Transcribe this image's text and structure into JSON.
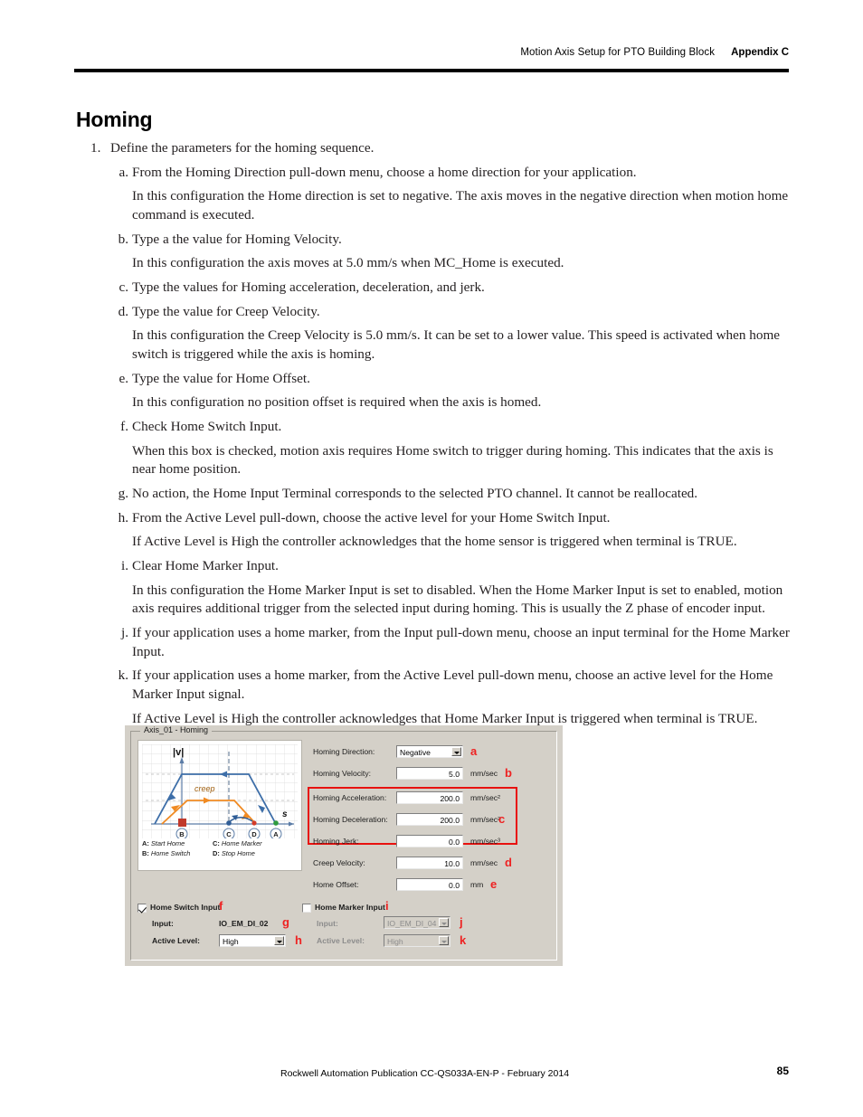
{
  "header": {
    "running_head": "Motion Axis Setup for PTO Building Block",
    "appendix": "Appendix C"
  },
  "page_title": "Homing",
  "steps": {
    "step1_marker": "1.",
    "step1_text": "Define the parameters for the homing sequence.",
    "items": [
      {
        "marker": "a.",
        "text": "From the Homing Direction pull-down menu, choose a home direction for your application."
      },
      {
        "marker": "b.",
        "text": "Type a the value for Homing Velocity."
      },
      {
        "marker": "c.",
        "text": "Type the values for Homing acceleration, deceleration, and jerk."
      },
      {
        "marker": "d.",
        "text": "Type the value for Creep Velocity."
      },
      {
        "marker": "e.",
        "text": "Type the value for Home Offset."
      },
      {
        "marker": "f.",
        "text": "Check Home Switch Input."
      },
      {
        "marker": "g.",
        "text": "No action, the Home Input Terminal corresponds to the selected PTO channel. It cannot be reallocated."
      },
      {
        "marker": "h.",
        "text": "From the Active Level pull-down, choose the active level for your Home Switch Input."
      },
      {
        "marker": "i.",
        "text": "Clear Home Marker Input."
      },
      {
        "marker": "j.",
        "text": "If your application uses a home marker, from the Input pull-down menu, choose an input terminal for the Home Marker Input."
      },
      {
        "marker": "k.",
        "text": "If your application uses a home marker, from the Active Level pull-down menu, choose an active level for the Home Marker Input signal."
      }
    ],
    "notes": {
      "a": "In this configuration the Home direction is set to negative. The axis moves in the negative direction when motion home command is executed.",
      "b": "In this configuration the axis moves at 5.0 mm/s when MC_Home is executed.",
      "d": "In this configuration the Creep Velocity is 5.0 mm/s. It can be set to a lower value. This speed is activated when home switch is triggered while the axis is homing.",
      "e": "In this configuration no position offset is required when the axis is homed.",
      "f": "When this box is checked, motion axis requires Home switch to trigger during homing. This indicates that the axis is near home position.",
      "h": "If Active Level is High the controller acknowledges that the home sensor is triggered when terminal is TRUE.",
      "i": "In this configuration the Home Marker Input is set to disabled. When the Home Marker Input is set to enabled, motion axis requires additional trigger from the selected input during homing. This is usually the Z phase of encoder input.",
      "k": "If Active Level is High the controller acknowledges that Home Marker Input is triggered when terminal is TRUE."
    }
  },
  "dialog": {
    "groupbox_title": "Axis_01 - Homing",
    "chart": {
      "y_axis_label": "|v|",
      "x_axis_label": "s",
      "creep_label": "creep",
      "point_labels": [
        "B",
        "C",
        "D",
        "A"
      ],
      "legend": [
        {
          "key": "A:",
          "value": "Start Home"
        },
        {
          "key": "C:",
          "value": "Home Marker"
        },
        {
          "key": "B:",
          "value": "Home Switch"
        },
        {
          "key": "D:",
          "value": "Stop Home"
        }
      ]
    },
    "fields": [
      {
        "label": "Homing Direction:",
        "value": "Negative",
        "unit": "",
        "type": "select",
        "annotation": "a"
      },
      {
        "label": "Homing Velocity:",
        "value": "5.0",
        "unit": "mm/sec",
        "type": "text",
        "annotation": "b"
      },
      {
        "label": "Homing Acceleration:",
        "value": "200.0",
        "unit": "mm/sec²",
        "type": "text",
        "annotation": ""
      },
      {
        "label": "Homing Deceleration:",
        "value": "200.0",
        "unit": "mm/sec²",
        "type": "text",
        "annotation": "c"
      },
      {
        "label": "Homing Jerk:",
        "value": "0.0",
        "unit": "mm/sec³",
        "type": "text",
        "annotation": ""
      },
      {
        "label": "Creep Velocity:",
        "value": "10.0",
        "unit": "mm/sec",
        "type": "text",
        "annotation": "d"
      },
      {
        "label": "Home Offset:",
        "value": "0.0",
        "unit": "mm",
        "type": "text",
        "annotation": "e"
      }
    ],
    "home_switch": {
      "checkbox_label": "Home Switch Input",
      "checked": true,
      "input_label": "Input:",
      "input_value": "IO_EM_DI_02",
      "active_level_label": "Active Level:",
      "active_level_value": "High",
      "annotation_checkbox": "f",
      "annotation_input": "g",
      "annotation_level": "h"
    },
    "home_marker": {
      "checkbox_label": "Home Marker Input",
      "checked": false,
      "input_label": "Input:",
      "input_value": "IO_EM_DI_04",
      "active_level_label": "Active Level:",
      "active_level_value": "High",
      "annotation_checkbox": "i",
      "annotation_input": "j",
      "annotation_level": "k"
    },
    "highlight_color": "#e8110f"
  },
  "footer": {
    "publication": "Rockwell Automation Publication CC-QS033A-EN-P - February 2014",
    "page_number": "85"
  }
}
